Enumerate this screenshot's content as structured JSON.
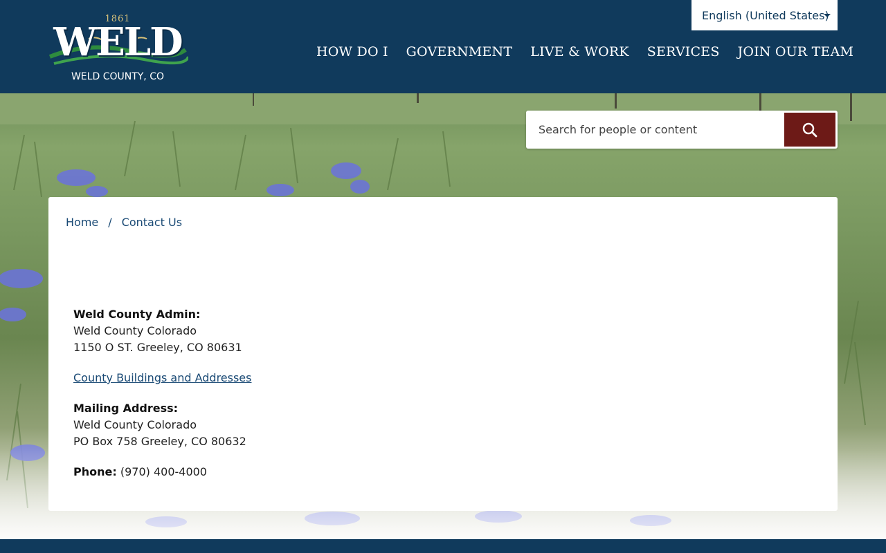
{
  "header": {
    "logo": {
      "year": "1861",
      "name": "WELD",
      "subtitle": "WELD COUNTY, CO"
    },
    "language": {
      "selected": "English (United States)"
    },
    "nav": [
      {
        "label": "HOW DO I"
      },
      {
        "label": "GOVERNMENT"
      },
      {
        "label": "LIVE & WORK"
      },
      {
        "label": "SERVICES"
      },
      {
        "label": "JOIN OUR TEAM"
      }
    ]
  },
  "search": {
    "placeholder": "Search for people or content",
    "icon": "search-icon"
  },
  "breadcrumb": {
    "home": "Home",
    "separator": "/",
    "current": "Contact Us"
  },
  "contact": {
    "admin_heading": "Weld County Admin:",
    "admin_line1": "Weld County Colorado",
    "admin_line2": "1150 O ST. Greeley, CO 80631",
    "buildings_link": "County Buildings and Addresses",
    "mailing_heading": "Mailing Address:",
    "mailing_line1": "Weld County Colorado",
    "mailing_line2": "PO Box 758 Greeley, CO 80632",
    "phone_label": "Phone:",
    "phone_value": "(970) 400-4000"
  },
  "colors": {
    "header_bg": "#103a5c",
    "search_button": "#6d1a17",
    "link": "#1a4a75"
  }
}
